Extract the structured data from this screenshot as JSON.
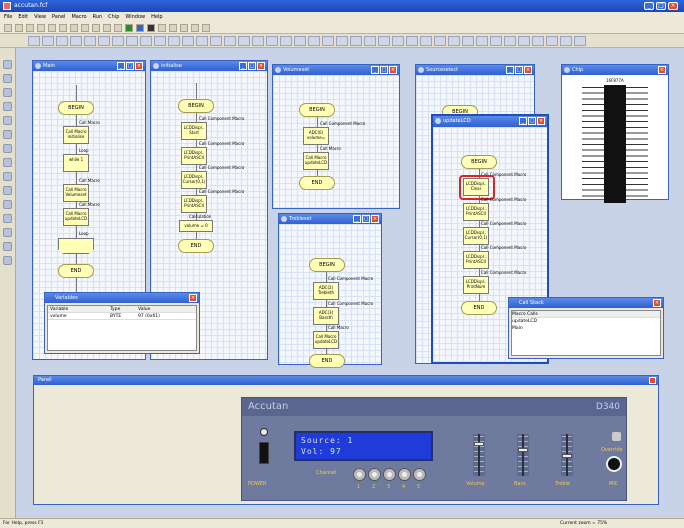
{
  "app": {
    "title": "accutan.fcf"
  },
  "menu": [
    "File",
    "Edit",
    "View",
    "Panel",
    "Macro",
    "Run",
    "Chip",
    "Window",
    "Help"
  ],
  "windows": {
    "main": {
      "title": "Main",
      "begin": "BEGIN",
      "end": "END",
      "blocks": [
        "Call Macro initialise",
        "while 1",
        "Call Macro Volumeset",
        "Call Macro updateLCD",
        "Loop"
      ],
      "labels": [
        "Call Macro",
        "Loop",
        "Call Macro",
        "Call Macro"
      ]
    },
    "initialise": {
      "title": "initialise",
      "begin": "BEGIN",
      "end": "END",
      "blocks": [
        "LCDDispl.. Start",
        "LCDDispl.. PrintASCII",
        "LCDDispl.. Cursor(0,1)",
        "LCDDispl.. PrintASCII",
        "volume = 0"
      ],
      "labels": [
        "Call Component Macro",
        "Call Component Macro",
        "Call Component Macro",
        "Call Component Macro",
        "Calculation"
      ]
    },
    "volumeset": {
      "title": "Volumeset",
      "begin": "BEGIN",
      "end": "END",
      "blocks": [
        "ADC(0) volume=",
        "Call Macro updateLCD"
      ],
      "labels": [
        "Call Component Macro",
        "Call Macro"
      ]
    },
    "trebleset": {
      "title": "Trebleset",
      "begin": "BEGIN",
      "end": "END",
      "blocks": [
        "ADC(2) Trebleth",
        "ADC(3) Bassth",
        "Call Macro updateLCD"
      ],
      "labels": [
        "Call Component Macro",
        "Call Component Macro",
        "Call Macro"
      ]
    },
    "sourceselect": {
      "title": "Sourceselect",
      "begin": "BEGIN"
    },
    "updatelcd": {
      "title": "updateLCD",
      "begin": "BEGIN",
      "end": "END",
      "blocks": [
        "LCDDispl.. Clear",
        "LCDDispl.. PrintASCII",
        "LCDDispl.. Cursor(0,1)",
        "LCDDispl.. PrintASCII",
        "LCDDispl.. PrintNum"
      ],
      "labels": [
        "Call Component Macro",
        "Call Component Macro",
        "Call Component Macro",
        "Call Component Macro",
        "Call Component Macro"
      ]
    },
    "chip": {
      "title": "Chip",
      "part": "16F877A"
    },
    "variables": {
      "title": "Variables",
      "columns": [
        "Variable",
        "Type",
        "Value"
      ],
      "rows": [
        [
          "volume",
          "BYTE",
          "97 (0x61)"
        ]
      ]
    },
    "callstack": {
      "title": "Call Stack",
      "header": "Macro Calls",
      "items": [
        "updateLCD",
        "Main"
      ]
    }
  },
  "panel": {
    "title": "Panel",
    "brand": "Accutan",
    "model": "D340",
    "lcd": {
      "line1": "Source: 1",
      "line2": "Vol: 97"
    },
    "power_label": "POWER",
    "channel_label": "Channel",
    "channels": [
      "1",
      "2",
      "3",
      "4",
      "5"
    ],
    "faders": [
      "Volume",
      "Bass",
      "Treble"
    ],
    "override_label": "Override",
    "mic_label": "MIC"
  },
  "status": {
    "left": "For Help, press F1",
    "right": "Current zoom = 75%"
  },
  "colors": {
    "accent": "#2f61d2",
    "lcd": "#1f3bd8",
    "highlight": "#dd2222",
    "panel": "#6f7a9f"
  }
}
